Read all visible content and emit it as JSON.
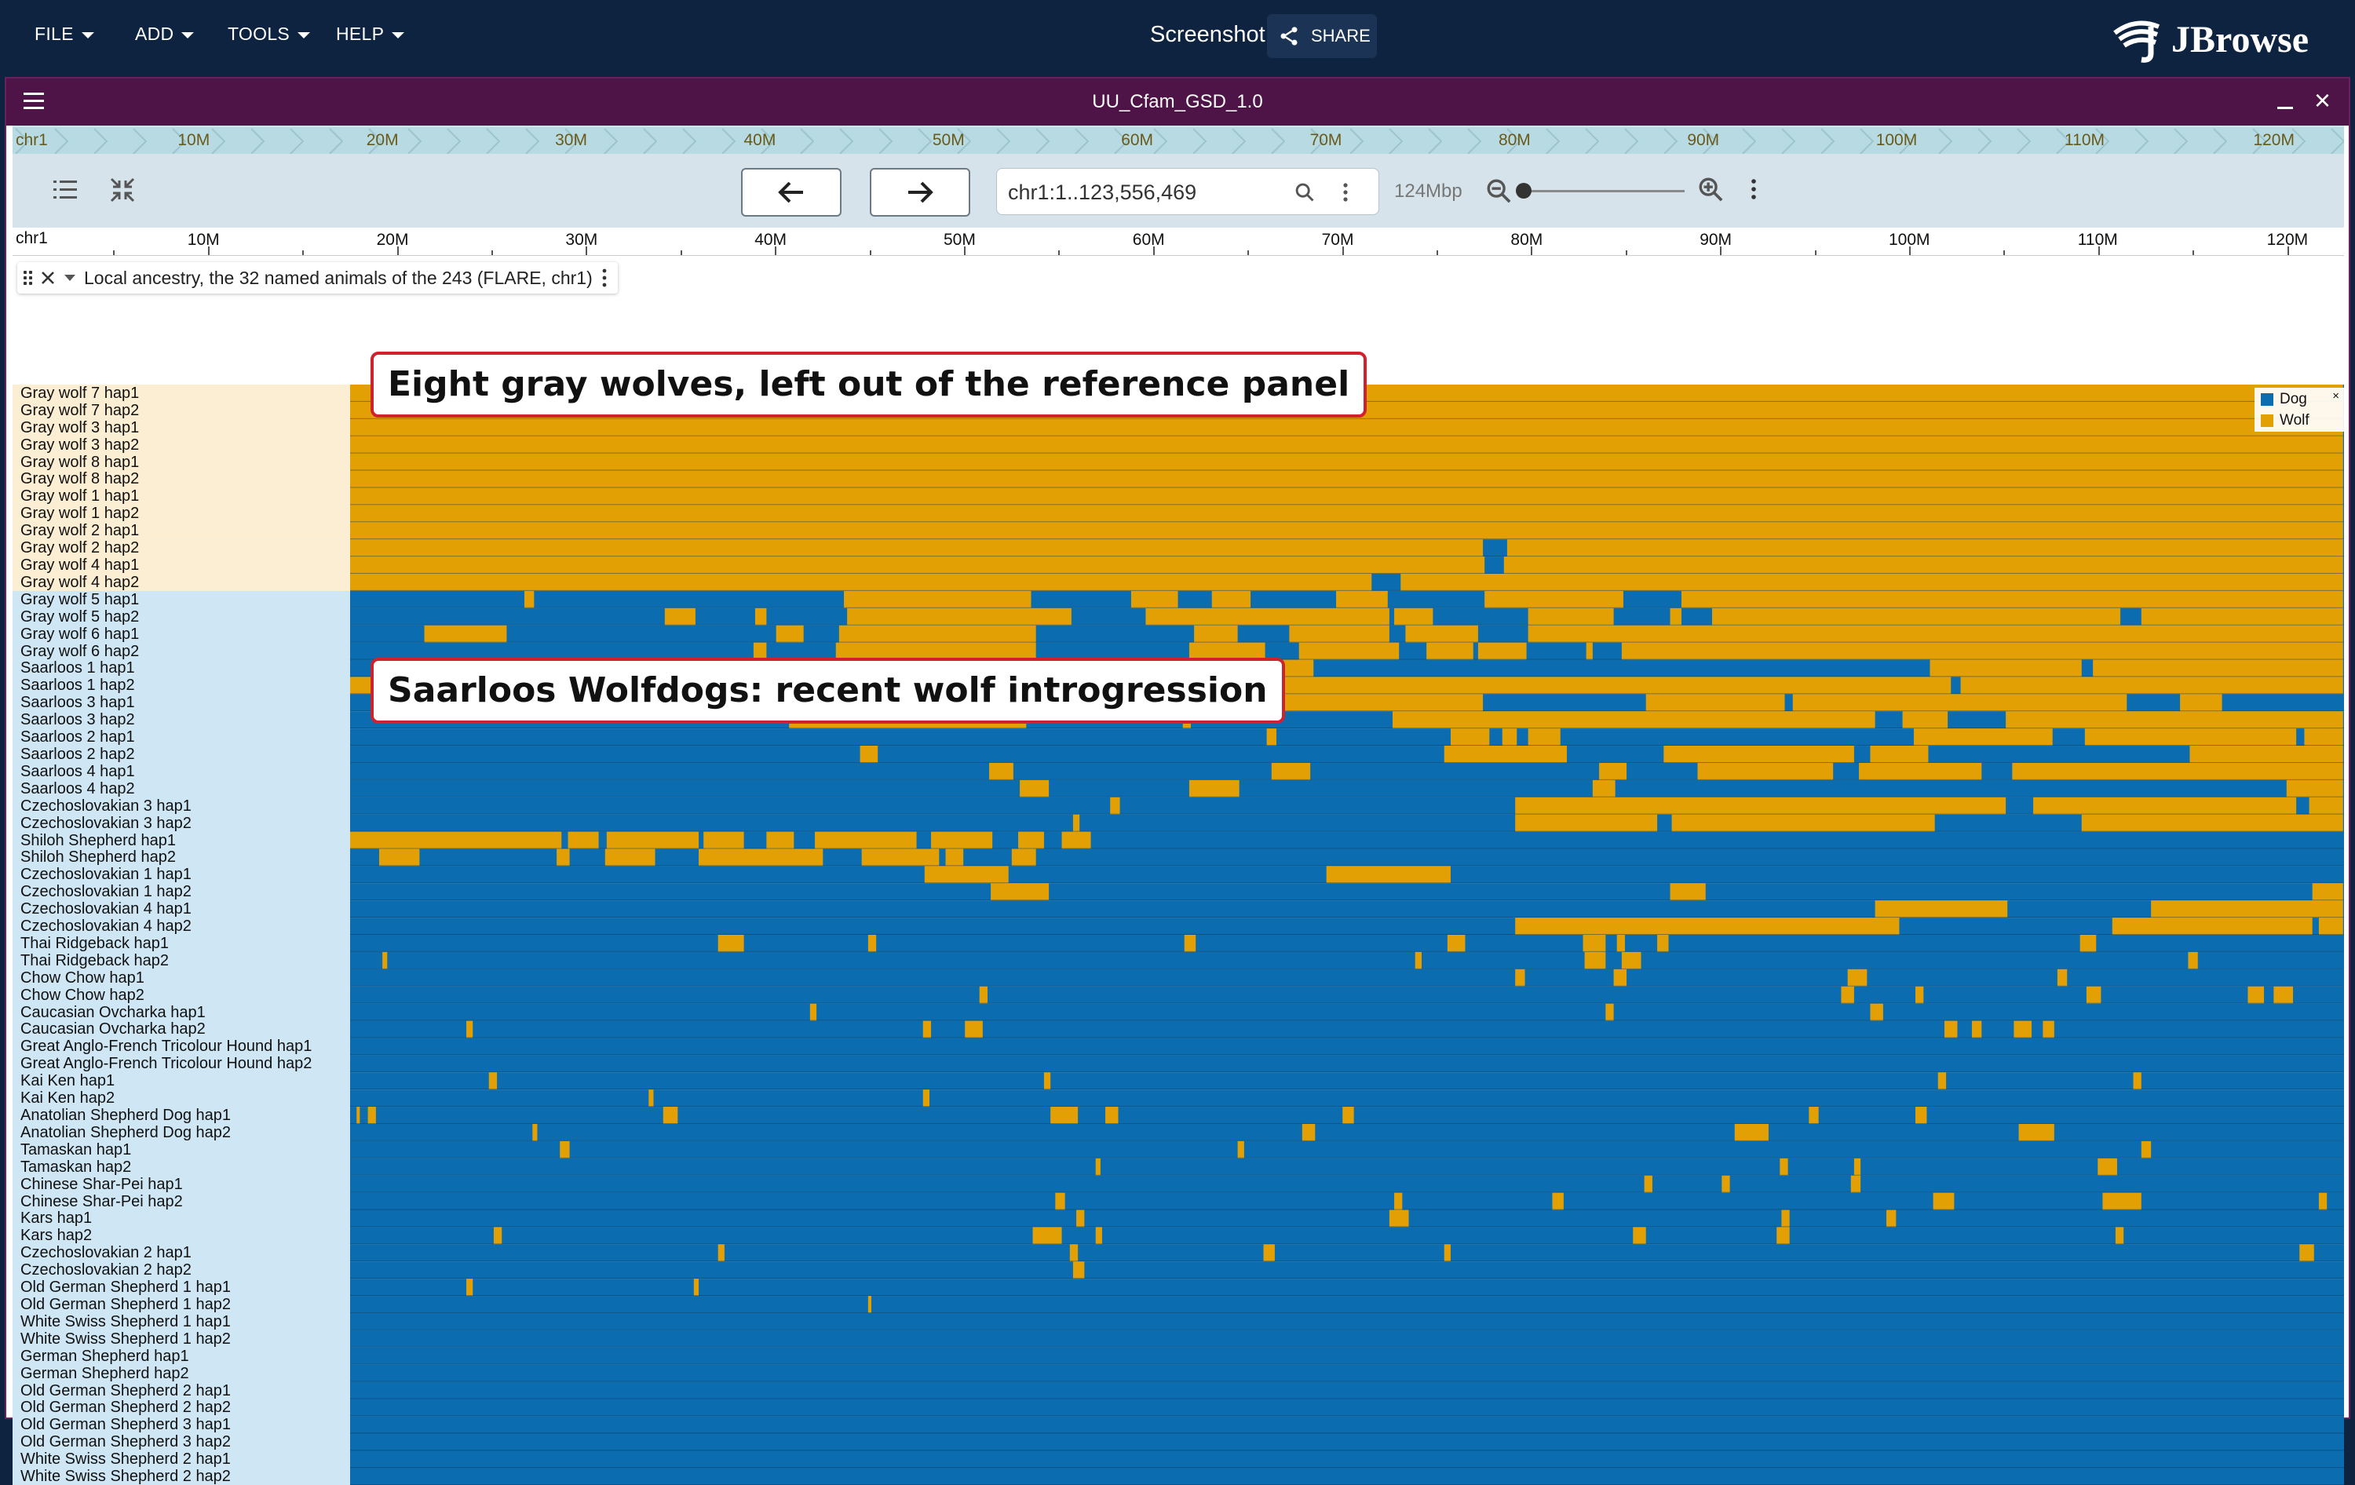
{
  "app": {
    "menus": [
      "FILE",
      "ADD",
      "TOOLS",
      "HELP"
    ],
    "session_title": "Screenshot",
    "share_label": "SHARE",
    "logo_text": "JBrowse"
  },
  "view": {
    "title": "UU_Cfam_GSD_1.0",
    "overview_labels": [
      "chr1",
      "10M",
      "20M",
      "30M",
      "40M",
      "50M",
      "60M",
      "70M",
      "80M",
      "90M",
      "100M",
      "110M",
      "120M"
    ],
    "locstring": "chr1:1..123,556,469",
    "bp_per_px_label": "124Mbp",
    "ruler_labels": [
      "chr1",
      "10M",
      "20M",
      "30M",
      "40M",
      "50M",
      "60M",
      "70M",
      "80M",
      "90M",
      "100M",
      "110M",
      "120M"
    ]
  },
  "track": {
    "name": "Local ancestry, the 32 named animals of the 243 (FLARE, chr1)",
    "legend": [
      {
        "label": "Dog",
        "color": "#0b6db0"
      },
      {
        "label": "Wolf",
        "color": "#e2a004"
      }
    ],
    "row_labels": [
      "Gray wolf 7 hap1",
      "Gray wolf 7 hap2",
      "Gray wolf 3 hap1",
      "Gray wolf 3 hap2",
      "Gray wolf 8 hap1",
      "Gray wolf 8 hap2",
      "Gray wolf 1 hap1",
      "Gray wolf 1 hap2",
      "Gray wolf 2 hap1",
      "Gray wolf 2 hap2",
      "Gray wolf 4 hap1",
      "Gray wolf 4 hap2",
      "Gray wolf 5 hap1",
      "Gray wolf 5 hap2",
      "Gray wolf 6 hap1",
      "Gray wolf 6 hap2",
      "Saarloos 1 hap1",
      "Saarloos 1 hap2",
      "Saarloos 3 hap1",
      "Saarloos 3 hap2",
      "Saarloos 2 hap1",
      "Saarloos 2 hap2",
      "Saarloos 4 hap1",
      "Saarloos 4 hap2",
      "Czechoslovakian 3 hap1",
      "Czechoslovakian 3 hap2",
      "Shiloh Shepherd hap1",
      "Shiloh Shepherd hap2",
      "Czechoslovakian 1 hap1",
      "Czechoslovakian 1 hap2",
      "Czechoslovakian 4 hap1",
      "Czechoslovakian 4 hap2",
      "Thai Ridgeback hap1",
      "Thai Ridgeback hap2",
      "Chow Chow hap1",
      "Chow Chow hap2",
      "Caucasian Ovcharka hap1",
      "Caucasian Ovcharka hap2",
      "Great Anglo-French Tricolour Hound hap1",
      "Great Anglo-French Tricolour Hound hap2",
      "Kai Ken hap1",
      "Kai Ken hap2",
      "Anatolian Shepherd Dog hap1",
      "Anatolian Shepherd Dog hap2",
      "Tamaskan hap1",
      "Tamaskan hap2",
      "Chinese Shar-Pei hap1",
      "Chinese Shar-Pei hap2",
      "Kars hap1",
      "Kars hap2",
      "Czechoslovakian 2 hap1",
      "Czechoslovakian 2 hap2",
      "Old German Shepherd 1 hap1",
      "Old German Shepherd 1 hap2",
      "White Swiss Shepherd 1 hap1",
      "White Swiss Shepherd 1 hap2",
      "German Shepherd hap1",
      "German Shepherd hap2",
      "Old German Shepherd 2 hap1",
      "Old German Shepherd 2 hap2",
      "Old German Shepherd 3 hap1",
      "Old German Shepherd 3 hap2",
      "White Swiss Shepherd 2 hap1",
      "White Swiss Shepherd 2 hap2"
    ],
    "wolf_segments": [
      [
        [
          0,
          123.5
        ]
      ],
      [
        [
          0,
          123.5
        ]
      ],
      [
        [
          0,
          123.5
        ]
      ],
      [
        [
          0,
          123.5
        ]
      ],
      [
        [
          0,
          123.5
        ]
      ],
      [
        [
          0,
          123.5
        ]
      ],
      [
        [
          0,
          123.5
        ]
      ],
      [
        [
          0,
          123.5
        ]
      ],
      [
        [
          0,
          123.5
        ]
      ],
      [
        [
          0,
          70.2
        ],
        [
          71.7,
          123.5
        ]
      ],
      [
        [
          0,
          70.3
        ],
        [
          71.5,
          123.5
        ]
      ],
      [
        [
          0,
          63.3
        ],
        [
          65.1,
          123.5
        ]
      ],
      [
        [
          10.8,
          11.4
        ],
        [
          30.6,
          42.2
        ],
        [
          48.4,
          51.3
        ],
        [
          53.4,
          55.8
        ],
        [
          61.1,
          64.3
        ],
        [
          70.3,
          78.9
        ],
        [
          82.5,
          123.5
        ]
      ],
      [
        [
          19.5,
          21.4
        ],
        [
          25.1,
          25.8
        ],
        [
          30.8,
          44.7
        ],
        [
          49.3,
          64.4
        ],
        [
          64.7,
          67.1
        ],
        [
          73.0,
          78.3
        ],
        [
          81.8,
          82.5
        ],
        [
          84.4,
          109.7
        ],
        [
          111.0,
          123.5
        ]
      ],
      [
        [
          4.6,
          9.7
        ],
        [
          26.4,
          28.1
        ],
        [
          30.3,
          42.5
        ],
        [
          52.3,
          55.0
        ],
        [
          58.2,
          64.4
        ],
        [
          65.4,
          69.9
        ],
        [
          73.0,
          123.5
        ]
      ],
      [
        [
          25.0,
          25.8
        ],
        [
          30.1,
          42.5
        ],
        [
          52.0,
          56.7
        ],
        [
          58.8,
          65.0
        ],
        [
          66.7,
          69.6
        ],
        [
          69.9,
          72.9
        ],
        [
          76.6,
          77.0
        ],
        [
          78.8,
          123.5
        ]
      ],
      [
        [
          13.8,
          17.9
        ],
        [
          37.8,
          59.7
        ],
        [
          97.9,
          107.3
        ],
        [
          108.0,
          123.5
        ]
      ],
      [
        [
          0,
          7.2
        ],
        [
          13.0,
          13.6
        ],
        [
          18.1,
          99.2
        ],
        [
          99.8,
          123.5
        ]
      ],
      [
        [
          13.2,
          26.8
        ],
        [
          41.6,
          51.3
        ],
        [
          51.8,
          70.2
        ],
        [
          80.3,
          88.9
        ],
        [
          89.4,
          110.1
        ],
        [
          113.4,
          116.0
        ]
      ],
      [
        [
          27.2,
          41.9
        ],
        [
          51.6,
          52.1
        ],
        [
          64.6,
          94.5
        ],
        [
          96.2,
          99.0
        ],
        [
          102.6,
          123.5
        ]
      ],
      [
        [
          56.8,
          57.4
        ],
        [
          68.2,
          70.6
        ],
        [
          71.4,
          72.3
        ],
        [
          73.0,
          75.0
        ],
        [
          96.9,
          105.5
        ],
        [
          107.5,
          120.6
        ],
        [
          121.1,
          123.5
        ]
      ],
      [
        [
          31.6,
          32.7
        ],
        [
          67.8,
          75.4
        ],
        [
          81.4,
          93.2
        ],
        [
          94.2,
          97.8
        ],
        [
          114.0,
          123.5
        ]
      ],
      [
        [
          39.6,
          41.1
        ],
        [
          57.1,
          59.5
        ],
        [
          77.4,
          79.1
        ],
        [
          83.5,
          91.9
        ],
        [
          93.5,
          101.1
        ],
        [
          103.0,
          123.5
        ]
      ],
      [
        [
          41.5,
          43.3
        ],
        [
          52.0,
          55.1
        ],
        [
          77.0,
          78.4
        ],
        [
          120.0,
          123.5
        ]
      ],
      [
        [
          47.1,
          47.7
        ],
        [
          72.2,
          102.6
        ],
        [
          104.3,
          120.6
        ],
        [
          121.4,
          123.5
        ]
      ],
      [
        [
          44.8,
          45.2
        ],
        [
          72.2,
          81.0
        ],
        [
          81.9,
          98.2
        ],
        [
          107.3,
          123.5
        ]
      ],
      [
        [
          0,
          13.1
        ],
        [
          13.5,
          15.4
        ],
        [
          15.9,
          21.6
        ],
        [
          21.9,
          24.4
        ],
        [
          25.8,
          27.5
        ],
        [
          28.8,
          35.1
        ],
        [
          36.0,
          39.8
        ],
        [
          41.4,
          43.0
        ],
        [
          44.1,
          45.9
        ]
      ],
      [
        [
          1.8,
          4.3
        ],
        [
          12.8,
          13.6
        ],
        [
          15.8,
          18.9
        ],
        [
          21.6,
          29.3
        ],
        [
          31.7,
          36.5
        ],
        [
          36.9,
          38.0
        ],
        [
          41.0,
          42.5
        ]
      ],
      [
        [
          35.6,
          40.8
        ],
        [
          60.5,
          68.2
        ]
      ],
      [
        [
          39.7,
          43.3
        ],
        [
          81.8,
          84.0
        ],
        [
          121.6,
          123.5
        ]
      ],
      [
        [
          94.5,
          102.7
        ],
        [
          111.6,
          123.5
        ]
      ],
      [
        [
          72.2,
          96.0
        ],
        [
          109.2,
          121.6
        ],
        [
          122.0,
          123.5
        ]
      ],
      [
        [
          22.8,
          24.4
        ],
        [
          32.1,
          32.6
        ],
        [
          51.7,
          52.4
        ],
        [
          68.0,
          69.1
        ],
        [
          76.4,
          77.8
        ],
        [
          78.5,
          79.0
        ],
        [
          81.0,
          81.7
        ],
        [
          107.2,
          108.2
        ]
      ],
      [
        [
          2.0,
          2.3
        ],
        [
          66.0,
          66.4
        ],
        [
          76.5,
          77.8
        ],
        [
          78.8,
          80.0
        ],
        [
          113.9,
          114.5
        ]
      ],
      [
        [
          72.2,
          72.8
        ],
        [
          78.3,
          79.1
        ],
        [
          92.8,
          94.0
        ],
        [
          105.8,
          106.4
        ]
      ],
      [
        [
          39.0,
          39.5
        ],
        [
          92.4,
          93.2
        ],
        [
          97.0,
          97.5
        ],
        [
          107.6,
          108.5
        ],
        [
          117.6,
          118.6
        ],
        [
          119.2,
          120.4
        ]
      ],
      [
        [
          28.5,
          28.9
        ],
        [
          77.8,
          78.3
        ],
        [
          94.2,
          95.0
        ]
      ],
      [
        [
          7.2,
          7.6
        ],
        [
          35.5,
          36.0
        ],
        [
          38.1,
          39.2
        ],
        [
          98.8,
          99.6
        ],
        [
          100.5,
          101.1
        ],
        [
          103.1,
          104.2
        ],
        [
          104.9,
          105.6
        ]
      ],
      [],
      [],
      [
        [
          8.6,
          9.1
        ],
        [
          43.0,
          43.4
        ],
        [
          98.4,
          98.9
        ],
        [
          110.5,
          111.0
        ]
      ],
      [
        [
          18.5,
          18.8
        ],
        [
          35.5,
          35.9
        ]
      ],
      [
        [
          0.4,
          0.6
        ],
        [
          1.1,
          1.6
        ],
        [
          19.4,
          20.3
        ],
        [
          43.4,
          45.1
        ],
        [
          46.8,
          47.6
        ],
        [
          61.5,
          62.2
        ],
        [
          90.4,
          91.0
        ],
        [
          97.0,
          97.7
        ]
      ],
      [
        [
          11.3,
          11.6
        ],
        [
          59.0,
          59.8
        ],
        [
          85.8,
          87.9
        ],
        [
          103.4,
          105.6
        ]
      ],
      [
        [
          13.0,
          13.6
        ],
        [
          55.0,
          55.4
        ],
        [
          111.0,
          111.6
        ]
      ],
      [
        [
          46.2,
          46.5
        ],
        [
          88.6,
          89.1
        ],
        [
          93.2,
          93.6
        ],
        [
          108.3,
          109.5
        ]
      ],
      [
        [
          80.2,
          80.7
        ],
        [
          85.0,
          85.5
        ],
        [
          93.0,
          93.6
        ]
      ],
      [
        [
          43.7,
          44.3
        ],
        [
          64.7,
          65.2
        ],
        [
          74.5,
          75.2
        ],
        [
          98.1,
          99.4
        ],
        [
          108.6,
          111.0
        ],
        [
          122.0,
          122.5
        ]
      ],
      [
        [
          45.0,
          45.5
        ],
        [
          64.4,
          65.6
        ],
        [
          88.7,
          89.2
        ],
        [
          95.2,
          95.8
        ]
      ],
      [
        [
          8.9,
          9.4
        ],
        [
          42.3,
          44.1
        ],
        [
          46.2,
          46.6
        ],
        [
          79.5,
          80.3
        ],
        [
          88.4,
          89.2
        ],
        [
          109.4,
          109.9
        ]
      ],
      [
        [
          22.8,
          23.2
        ],
        [
          44.6,
          45.1
        ],
        [
          56.6,
          57.3
        ],
        [
          67.8,
          68.2
        ],
        [
          120.8,
          121.7
        ]
      ],
      [
        [
          44.8,
          45.5
        ]
      ],
      [
        [
          7.2,
          7.6
        ],
        [
          21.3,
          21.6
        ]
      ],
      [
        [
          32.1,
          32.3
        ]
      ],
      [],
      [],
      [],
      [],
      [],
      [],
      [],
      []
    ]
  }
}
